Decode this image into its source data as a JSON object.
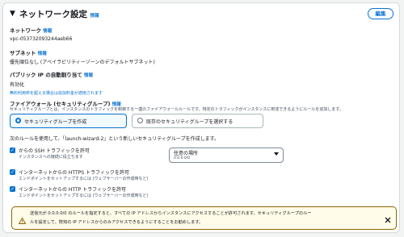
{
  "header": {
    "caret": "▼",
    "title": "ネットワーク設定",
    "info": "情報",
    "edit": "編集"
  },
  "network": {
    "label": "ネットワーク",
    "info": "情報",
    "value": "vpc-053732093244aeb66"
  },
  "subnet": {
    "label": "サブネット",
    "info": "情報",
    "value": "優先順位なし (アベイラビリティーゾーンのデフォルトサブネット)"
  },
  "public_ip": {
    "label": "パブリック IP の自動割り当て",
    "info": "情報",
    "value": "有効化",
    "note": "無料利用枠を超える場合は追加料金が適用されます"
  },
  "firewall": {
    "label": "ファイアウォール (セキュリティグループ)",
    "info": "情報",
    "desc": "セキュリティグループとは、インスタンスのトラフィックを制御する一連のファイアウォールルールです。特定のトラフィックがインスタンスに到達できるようにルールを追加します。",
    "options": [
      "セキュリティグループを作成",
      "既存のセキュリティグループを選択する"
    ]
  },
  "rules_heading": "次のルールを使用して、「launch-wizard-2」という新しいセキュリティグループを作成します。",
  "rules": [
    {
      "title": "からの SSH トラフィックを許可",
      "desc": "インスタンスへの接続に役立ちます"
    },
    {
      "title": "インターネットからの HTTPS トラフィックを許可",
      "desc": "エンドポイントをセットアップするには (ウェブサーバーの作成時など)"
    },
    {
      "title": "インターネットからの HTTP トラフィックを許可",
      "desc": "エンドポイントをセットアップするには (ウェブサーバーの作成時など)"
    }
  ],
  "source_select": {
    "value": "任意の場所",
    "sub": "0.0.0.0/0"
  },
  "warning": {
    "line1": "送信元が 0.0.0.0/0 のルールを指定すると、すべての IP アドレスからインスタンスにアクセスすることが許可されます。セキュリティグループのルー",
    "line2": "ルを設定して、既知の IP アドレスからのみアクセスできるようにすることをお勧めします。"
  },
  "colors": {
    "accent": "#0972d3",
    "warning_border": "#8d6605",
    "warning_bg": "#fffce9"
  }
}
